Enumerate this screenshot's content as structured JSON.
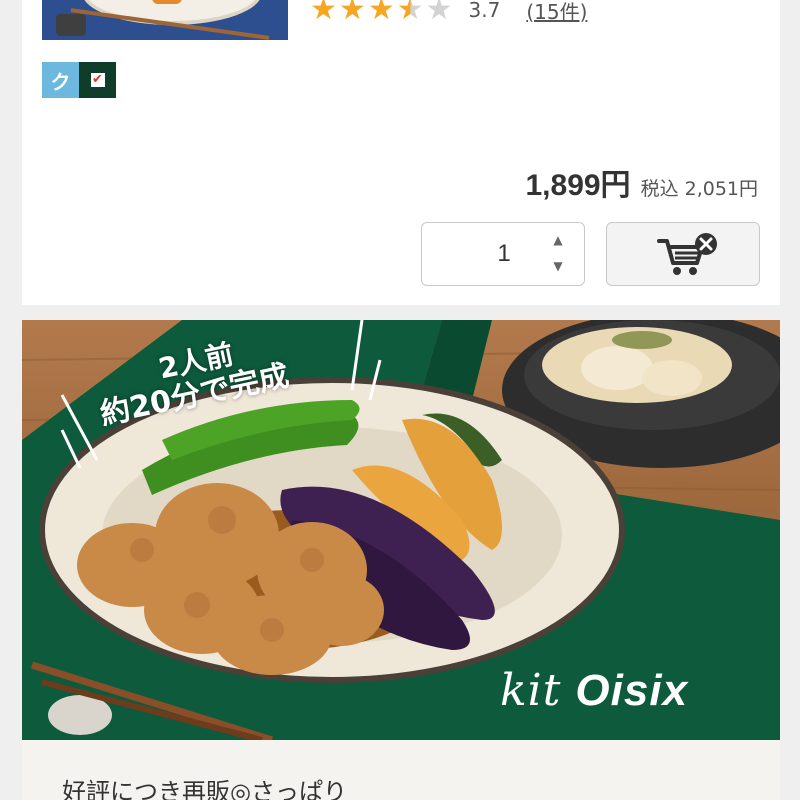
{
  "product": {
    "rating": {
      "value": "3.7",
      "count": "(15件)",
      "stars": [
        "full",
        "full",
        "full",
        "half",
        "empty"
      ]
    },
    "badges": [
      {
        "text": "ク",
        "color": "#6cb8df"
      },
      {
        "text": "✔",
        "color": "#0f3d2a"
      }
    ],
    "price": {
      "main": "1,899円",
      "tax": "税込 2,051円"
    },
    "quantity": {
      "value": "1",
      "up": "▲",
      "down": "▼"
    },
    "cart_button": {
      "icon": "cart-remove-icon"
    }
  },
  "banner": {
    "tag_line1": "2人前",
    "tag_line2": "約20分で完成",
    "brand_prefix": "kit",
    "brand_name": "Oisix"
  },
  "next_item": {
    "title": "好評につき再販◎さっぱり"
  },
  "colors": {
    "star": "#f5a623",
    "star_empty": "#d3d3d3",
    "page_bg": "#efefef"
  }
}
